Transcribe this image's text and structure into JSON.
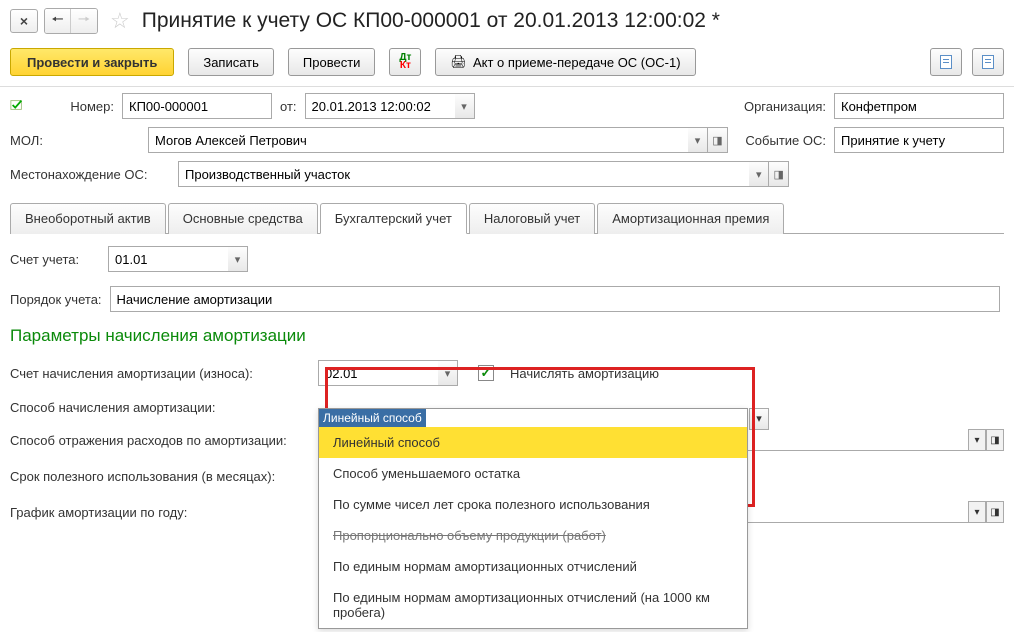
{
  "header": {
    "title": "Принятие к учету ОС КП00-000001 от 20.01.2013 12:00:02 *"
  },
  "toolbar": {
    "post_close": "Провести и закрыть",
    "save": "Записать",
    "post": "Провести",
    "act": "Акт о приеме-передаче ОС (ОС-1)"
  },
  "form": {
    "number_label": "Номер:",
    "number_value": "КП00-000001",
    "from_label": "от:",
    "date_value": "20.01.2013 12:00:02",
    "org_label": "Организация:",
    "org_value": "Конфетпром",
    "mol_label": "МОЛ:",
    "mol_value": "Могов Алексей Петрович",
    "event_label": "Событие ОС:",
    "event_value": "Принятие к учету",
    "location_label": "Местонахождение ОС:",
    "location_value": "Производственный участок"
  },
  "tabs": {
    "t1": "Внеоборотный актив",
    "t2": "Основные средства",
    "t3": "Бухгалтерский учет",
    "t4": "Налоговый учет",
    "t5": "Амортизационная премия"
  },
  "content": {
    "account_label": "Счет учета:",
    "account_value": "01.01",
    "order_label": "Порядок учета:",
    "order_value": "Начисление амортизации",
    "section_heading": "Параметры начисления амортизации",
    "amort_account_label": "Счет начисления амортизации (износа):",
    "amort_account_value": "02.01",
    "calc_amort_label": "Начислять амортизацию",
    "method_label": "Способ начисления амортизации:",
    "method_current": "Линейный способ",
    "expense_label": "Способ отражения расходов по амортизации:",
    "useful_life_label": "Срок полезного использования (в месяцах):",
    "schedule_label": "График амортизации по году:"
  },
  "dropdown": {
    "items": [
      {
        "label": "Линейный способ",
        "selected": true
      },
      {
        "label": "Способ уменьшаемого остатка"
      },
      {
        "label": "По сумме чисел лет срока полезного использования"
      },
      {
        "label": "Пропорционально объему продукции (работ)",
        "strike": true
      },
      {
        "label": "По единым нормам амортизационных отчислений"
      },
      {
        "label": "По единым нормам амортизационных отчислений (на 1000 км пробега)"
      }
    ]
  }
}
